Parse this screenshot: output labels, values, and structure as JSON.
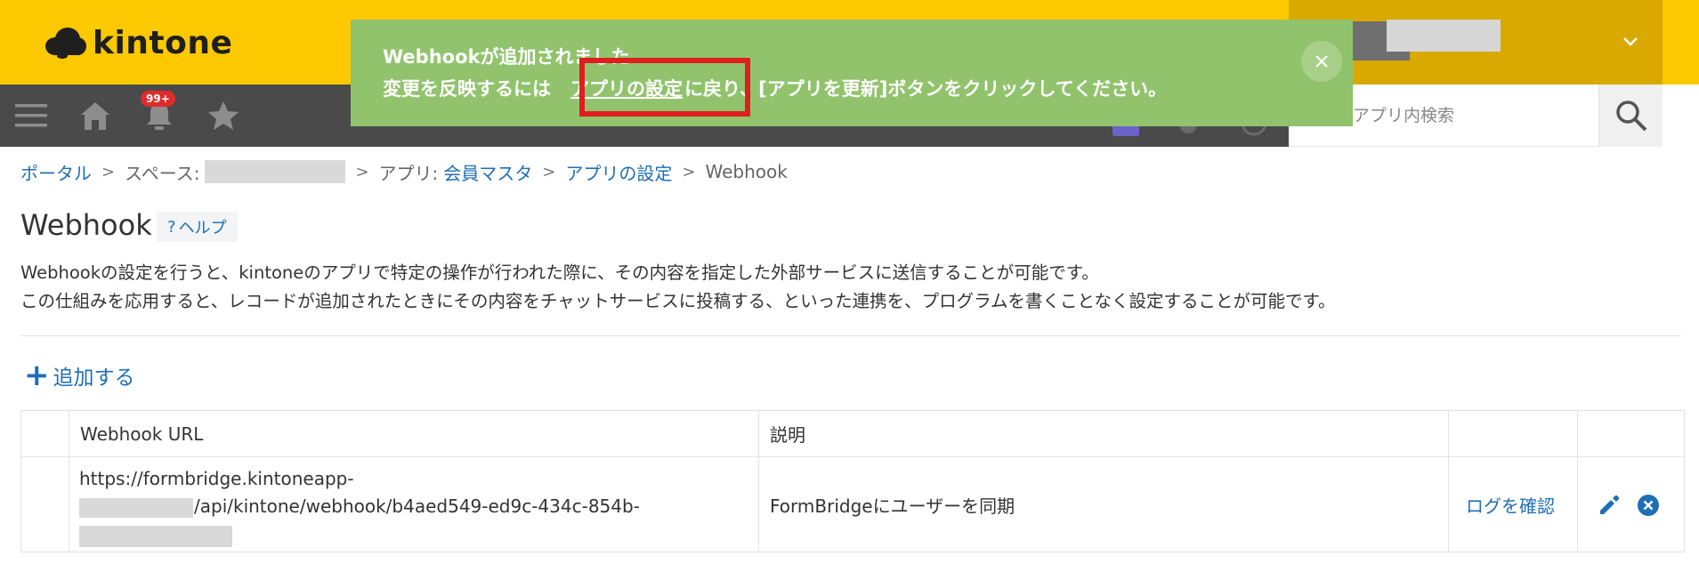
{
  "header": {
    "logo_text": "kintone",
    "brand_color": "#fcc800",
    "user_chevron_icon": "chevron-down-icon"
  },
  "nav": {
    "badge_count": "99+",
    "icons": [
      "menu-icon",
      "home-icon",
      "bell-icon",
      "star-icon"
    ]
  },
  "search": {
    "placeholder": "アプリ内検索",
    "icon": "search-icon"
  },
  "notification": {
    "title": "Webhookが追加されました",
    "line_prefix": "変更を反映するには",
    "link_text": "アプリの設定",
    "line_suffix": "に戻り、[アプリを更新]ボタンをクリックしてください。",
    "bg_color": "#91c36c",
    "highlight_color": "#e01e1e",
    "close_icon": "close-icon"
  },
  "breadcrumb": {
    "portal": "ポータル",
    "space_label": "スペース:",
    "app_label": "アプリ:",
    "app_name": "会員マスタ",
    "settings": "アプリの設定",
    "current": "Webhook",
    "separator": ">"
  },
  "page": {
    "title": "Webhook",
    "help_icon": "?",
    "help_label": "ヘルプ",
    "description_1": "Webhookの設定を行うと、kintoneのアプリで特定の操作が行われた際に、その内容を指定した外部サービスに送信することが可能です。",
    "description_2": "この仕組みを応用すると、レコードが追加されたときにその内容をチャットサービスに投稿する、といった連携を、プログラムを書くことなく設定することが可能です。",
    "add_icon": "+",
    "add_label": "追加する"
  },
  "table": {
    "headers": [
      "Webhook URL",
      "説明"
    ],
    "rows": [
      {
        "url_line1": "https://formbridge.kintoneapp-",
        "url_line2": "/api/kintone/webhook/b4aed549-ed9c-434c-854b-",
        "description": "FormBridgeにユーザーを同期",
        "log_link": "ログを確認",
        "edit_icon": "pencil-icon",
        "delete_icon": "delete-circle-icon"
      }
    ]
  }
}
